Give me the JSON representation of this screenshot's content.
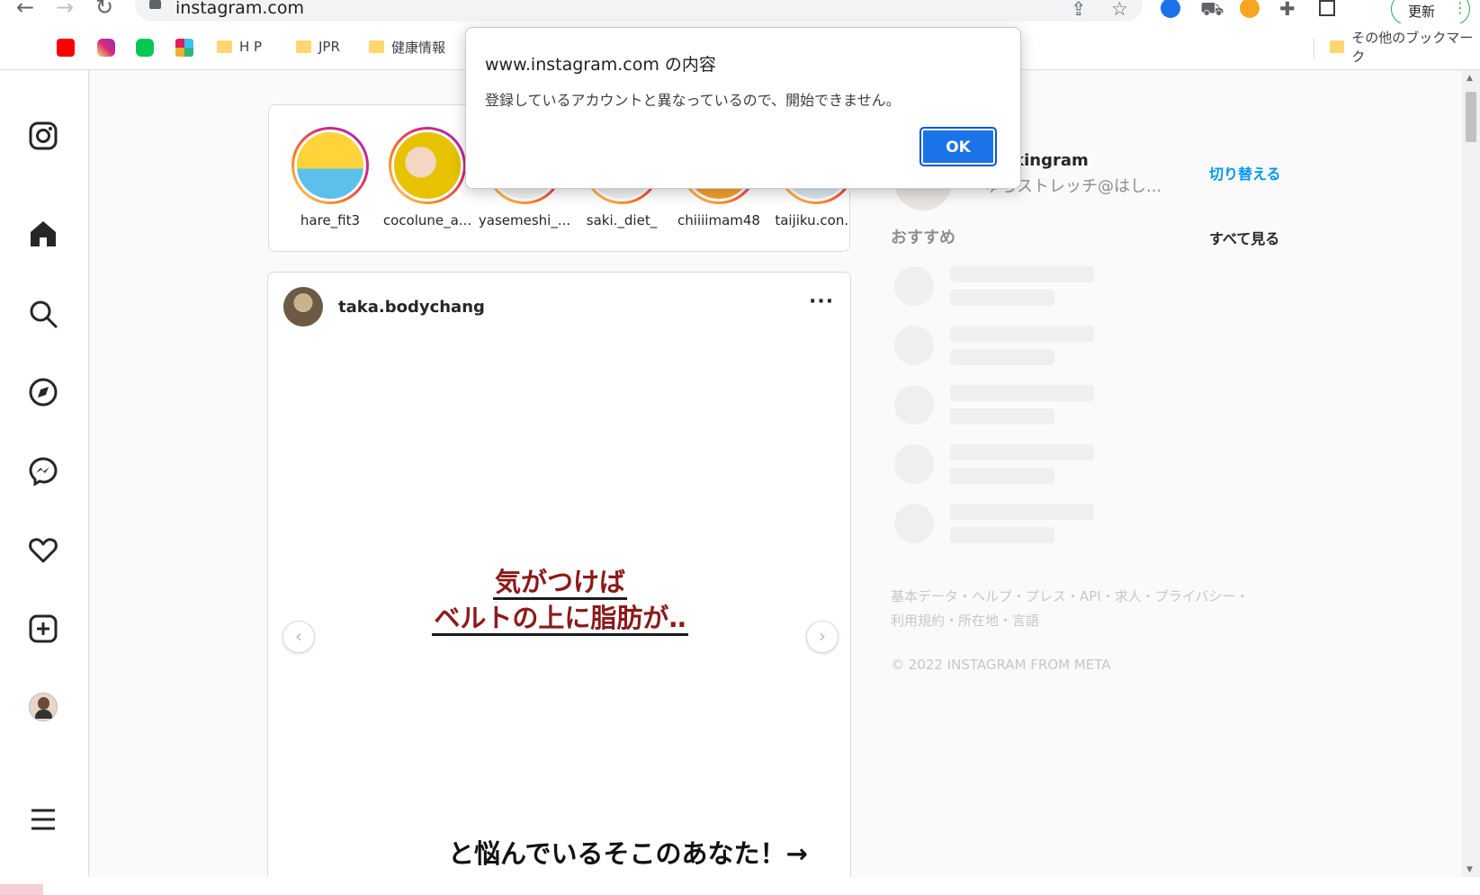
{
  "browser": {
    "url": "instagram.com",
    "update_label": "更新",
    "bookmarks": [
      "H P",
      "JPR",
      "健康情報"
    ],
    "other_bookmarks": "その他のブックマーク"
  },
  "stories": [
    {
      "name": "hare_fit3"
    },
    {
      "name": "cocolune_a..."
    },
    {
      "name": "yasemeshi_..."
    },
    {
      "name": "saki._diet_"
    },
    {
      "name": "chiiiimam48"
    },
    {
      "name": "taijiku.con..."
    }
  ],
  "post": {
    "username": "taka.bodychang",
    "image_text_line1": "気がつけば",
    "image_text_line2": "ベルトの上に脂肪が‥",
    "image_text_bottom": "と悩んでいるそこのあなた！→"
  },
  "sidebar": {
    "account_name": "ikingram",
    "account_subtitle": "ゆらストレッチ@はし...",
    "switch_label": "切り替える",
    "suggestions_title": "おすすめ",
    "see_all": "すべて見る",
    "footer_line1": "基本データ・ヘルプ・プレス・API・求人・プライバシー・",
    "footer_line2": "利用規約・所在地・言語",
    "copyright": "© 2022 INSTAGRAM FROM META"
  },
  "dialog": {
    "title": "www.instagram.com の内容",
    "message": "登録しているアカウントと異なっているので、開始できません。",
    "ok_label": "OK"
  },
  "colors": {
    "accent": "#1a73e8",
    "instagram_blue": "#0095f6",
    "text_red": "#8b1a1a"
  }
}
